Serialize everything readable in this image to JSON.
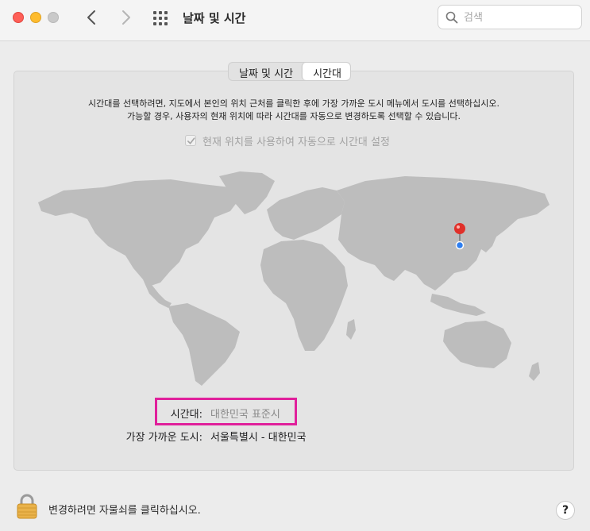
{
  "window": {
    "title": "날짜 및 시간"
  },
  "search": {
    "placeholder": "검색"
  },
  "tabs": [
    {
      "label": "날짜 및 시간",
      "active": false
    },
    {
      "label": "시간대",
      "active": true
    }
  ],
  "description": {
    "line1": "시간대를 선택하려면, 지도에서 본인의 위치 근처를 클릭한 후에 가장 가까운 도시 메뉴에서 도시를 선택하십시오.",
    "line2": "가능할 경우, 사용자의 현재 위치에 따라 시간대를 자동으로 변경하도록 선택할 수 있습니다."
  },
  "auto_timezone": {
    "label": "현재 위치를 사용하여 자동으로 시간대 설정",
    "checked": true,
    "enabled": false
  },
  "timezone": {
    "label": "시간대:",
    "value": "대한민국 표준시"
  },
  "closest_city": {
    "label": "가장 가까운 도시:",
    "value": "서울특별시 - 대한민국"
  },
  "footer": {
    "lock_text": "변경하려면 자물쇠를 클릭하십시오.",
    "help_label": "?"
  },
  "colors": {
    "highlight_box": "#e0209b",
    "land": "#bdbdbd",
    "pin_red": "#e0302a",
    "location_dot": "#2f7ff0"
  },
  "icons": [
    "back-arrow-icon",
    "forward-arrow-icon",
    "grid-icon",
    "search-icon",
    "checkmark-icon",
    "map-pin-icon",
    "lock-icon",
    "help-icon"
  ]
}
